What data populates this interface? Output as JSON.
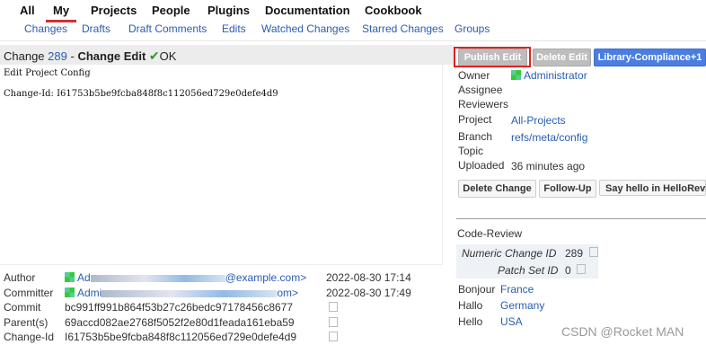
{
  "nav": {
    "main": [
      "All",
      "My",
      "Projects",
      "People",
      "Plugins",
      "Documentation",
      "Cookbook"
    ],
    "sub": [
      "Changes",
      "Drafts",
      "Draft Comments",
      "Edits",
      "Watched Changes",
      "Starred Changes",
      "Groups"
    ]
  },
  "header": {
    "prefix": "Change",
    "number": "289",
    "sep": " - ",
    "title": "Change Edit",
    "status": "OK"
  },
  "commit_message": {
    "line1": "Edit Project Config",
    "line2": "Change-Id: I61753b5be9fcba848f8c112056ed729e0defe4d9"
  },
  "actions": {
    "publish": "Publish Edit",
    "delete": "Delete Edit",
    "compliance": "Library-Compliance+1"
  },
  "info": {
    "owner_label": "Owner",
    "owner": "Administrator",
    "assignee_label": "Assignee",
    "reviewers_label": "Reviewers",
    "project_label": "Project",
    "project": "All-Projects",
    "branch_label": "Branch",
    "branch": "refs/meta/config",
    "topic_label": "Topic",
    "uploaded_label": "Uploaded",
    "uploaded": "36 minutes ago"
  },
  "buttons2": {
    "delete_change": "Delete Change",
    "follow_up": "Follow-Up",
    "say_hello": "Say hello in HelloRevis"
  },
  "code_review": {
    "title": "Code-Review",
    "numeric_label": "Numeric Change ID",
    "numeric": "289",
    "patch_label": "Patch Set ID",
    "patch": "0"
  },
  "greetings": [
    {
      "label": "Bonjour",
      "value": "France"
    },
    {
      "label": "Hallo",
      "value": "Germany"
    },
    {
      "label": "Hello",
      "value": "USA"
    }
  ],
  "meta": {
    "author_label": "Author",
    "author_name": "Ad",
    "author_email": "@example.com>",
    "author_date": "2022-08-30 17:14",
    "committer_label": "Committer",
    "committer_name": "Admi",
    "committer_email": "om>",
    "committer_date": "2022-08-30 17:49",
    "commit_label": "Commit",
    "commit": "bc991ff991b864f53b27c26bedc97178456c8677",
    "parents_label": "Parent(s)",
    "parents": "69accd082ae2768f5052f2e80d1feada161eba59",
    "changeid_label": "Change-Id",
    "changeid": "I61753b5be9fcba848f8c112056ed729e0defe4d9"
  },
  "watermark": "CSDN @Rocket MAN",
  "colors": {
    "link": "#2a5db0",
    "accent": "#cc3333",
    "blue_button": "#4a7fe0"
  }
}
